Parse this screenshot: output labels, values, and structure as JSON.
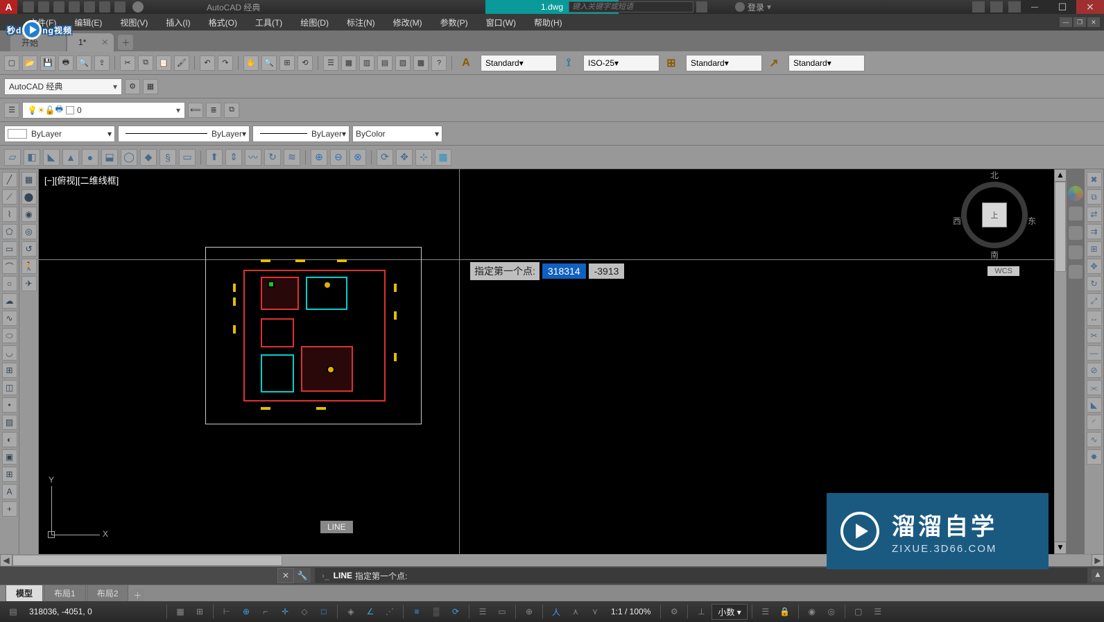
{
  "title": {
    "workspace_label": "AutoCAD 经典",
    "doc": "1.dwg",
    "search_ph": "键入关键字或短语",
    "login": "登录"
  },
  "menu": [
    "文件(F)",
    "编辑(E)",
    "视图(V)",
    "插入(I)",
    "格式(O)",
    "工具(T)",
    "绘图(D)",
    "标注(N)",
    "修改(M)",
    "参数(P)",
    "窗口(W)",
    "帮助(H)"
  ],
  "tabs": {
    "start": "开始",
    "doc": "1*"
  },
  "style": {
    "text": "Standard",
    "dim": "ISO-25",
    "table": "Standard",
    "mleader": "Standard"
  },
  "workspace_dd": "AutoCAD 经典",
  "layer": {
    "current": "0"
  },
  "props": {
    "color": "ByLayer",
    "ltype": "ByLayer",
    "lweight": "ByLayer",
    "plot": "ByColor"
  },
  "view": {
    "label": "[−][俯视][二维线框]",
    "wcs": "WCS",
    "line_tip": "LINE",
    "cube_top": "上",
    "north": "北",
    "south": "南",
    "east": "东",
    "west": "西"
  },
  "dyn": {
    "prompt": "指定第一个点:",
    "x": "318314",
    "y": "-3913"
  },
  "ucs": {
    "x": "X",
    "y": "Y"
  },
  "cmd": {
    "name": "LINE",
    "prompt": "指定第一个点:"
  },
  "layout": {
    "model": "模型",
    "l1": "布局1",
    "l2": "布局2"
  },
  "status": {
    "coord": "318036, -4051, 0",
    "zoom": "1:1 / 100%",
    "units": "小数"
  },
  "brand_top": "秒d  ng视频",
  "brand_ov": {
    "l1": "溜溜自学",
    "l2": "ZIXUE.3D66.COM"
  }
}
